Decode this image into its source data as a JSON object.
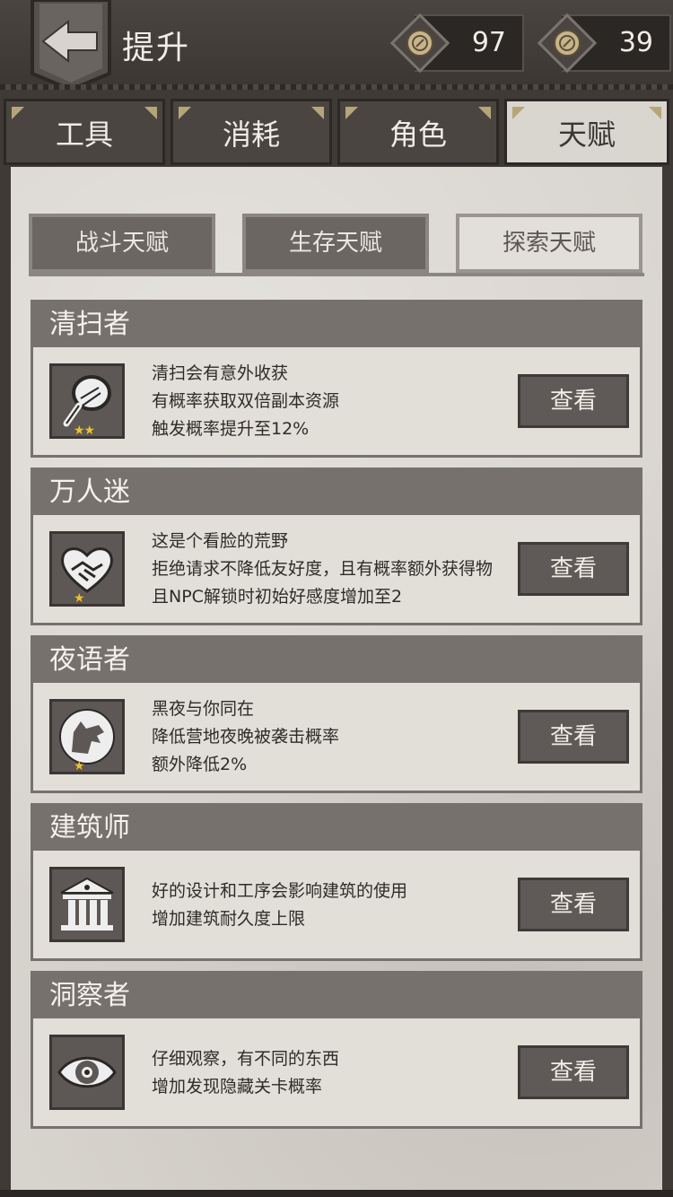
{
  "header": {
    "title": "提升"
  },
  "resources": [
    {
      "icon": "coin-icon",
      "value": "97"
    },
    {
      "icon": "coin-icon",
      "value": "39"
    }
  ],
  "tabs": [
    {
      "label": "工具",
      "active": false
    },
    {
      "label": "消耗",
      "active": false
    },
    {
      "label": "角色",
      "active": false
    },
    {
      "label": "天赋",
      "active": true
    }
  ],
  "subtabs": [
    {
      "label": "战斗天赋",
      "active": false
    },
    {
      "label": "生存天赋",
      "active": false
    },
    {
      "label": "探索天赋",
      "active": true
    }
  ],
  "talents": [
    {
      "name": "清扫者",
      "icon": "magnifier-icon",
      "stars": "★★",
      "lines": [
        "清扫会有意外收获",
        "有概率获取双倍副本资源",
        "触发概率提升至12%"
      ],
      "button": "查看"
    },
    {
      "name": "万人迷",
      "icon": "heart-handshake-icon",
      "stars": "★",
      "lines": [
        "这是个看脸的荒野",
        "拒绝请求不降低友好度，且有概率额外获得物",
        "且NPC解锁时初始好感度增加至2"
      ],
      "button": "查看"
    },
    {
      "name": "夜语者",
      "icon": "wolf-moon-icon",
      "stars": "★",
      "lines": [
        "黑夜与你同在",
        "降低营地夜晚被袭击概率",
        "额外降低2%"
      ],
      "button": "查看"
    },
    {
      "name": "建筑师",
      "icon": "building-icon",
      "stars": "",
      "lines": [
        "好的设计和工序会影响建筑的使用",
        "增加建筑耐久度上限"
      ],
      "button": "查看"
    },
    {
      "name": "洞察者",
      "icon": "eye-icon",
      "stars": "",
      "lines": [
        "仔细观察，有不同的东西",
        "增加发现隐藏关卡概率"
      ],
      "button": "查看"
    }
  ],
  "colors": {
    "accent_star": "#f0c020",
    "card_header": "#77716d",
    "button": "#5f5a57"
  }
}
